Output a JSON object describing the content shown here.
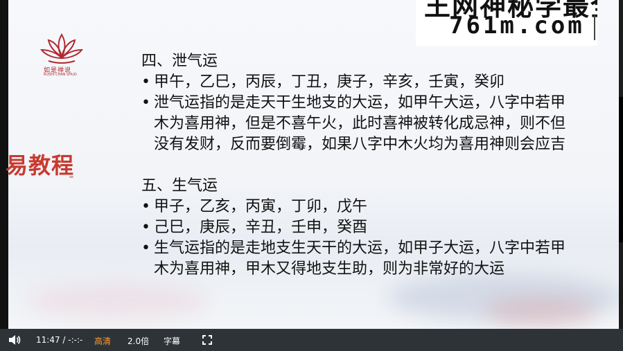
{
  "slide": {
    "logo": {
      "text": "如是禅说",
      "subtext": "RUSHI CHAN SHUO"
    },
    "side_title": "易教程",
    "watermark": {
      "top_text": "王网神秘学最全",
      "url": "761m.com"
    },
    "section4": {
      "heading": "四、泄气运",
      "bullet1": "甲午，乙巳，丙辰，丁丑，庚子，辛亥，壬寅，癸卯",
      "bullet2": "泄气运指的是走天干生地支的大运，如甲午大运，八字中若甲木为喜用神，但是不喜午火，此时喜神被转化成忌神，则不但没有发财，反而要倒霉，如果八字中木火均为喜用神则会应吉"
    },
    "section5": {
      "heading": "五、生气运",
      "bullet1": "甲子，乙亥，丙寅，丁卯，戊午",
      "bullet2": "己巳，庚辰，辛丑，壬申，癸酉",
      "bullet3": "生气运指的是走地支生天干的大运，如甲子大运，八字中若甲木为喜用神，甲木又得地支生助，则为非常好的大运"
    }
  },
  "player": {
    "time": "11:47 / -:-:-",
    "quality": "高清",
    "speed": "2.0倍",
    "subtitle": "字幕",
    "icons": {
      "volume": "volume-icon",
      "fullscreen": "fullscreen-icon"
    },
    "colors": {
      "bar": "#2e3338",
      "quality_active": "#ff9b2e"
    }
  }
}
